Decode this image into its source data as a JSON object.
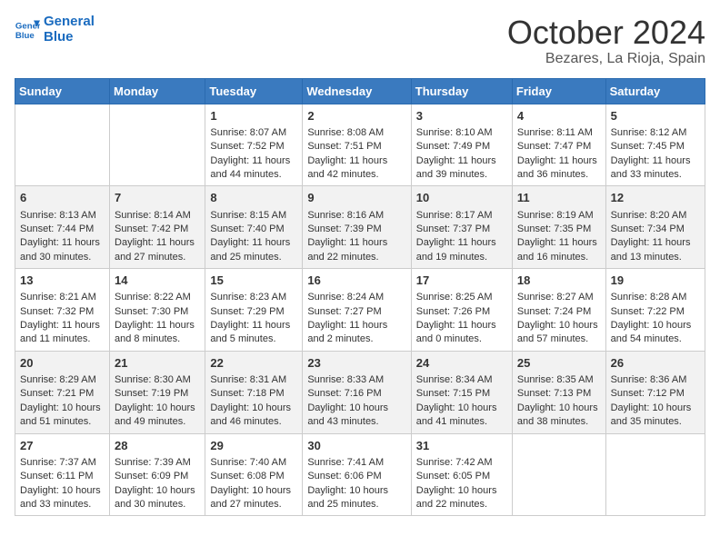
{
  "header": {
    "logo_line1": "General",
    "logo_line2": "Blue",
    "month": "October 2024",
    "location": "Bezares, La Rioja, Spain"
  },
  "days_of_week": [
    "Sunday",
    "Monday",
    "Tuesday",
    "Wednesday",
    "Thursday",
    "Friday",
    "Saturday"
  ],
  "weeks": [
    [
      {
        "day": "",
        "sunrise": "",
        "sunset": "",
        "daylight": ""
      },
      {
        "day": "",
        "sunrise": "",
        "sunset": "",
        "daylight": ""
      },
      {
        "day": "1",
        "sunrise": "Sunrise: 8:07 AM",
        "sunset": "Sunset: 7:52 PM",
        "daylight": "Daylight: 11 hours and 44 minutes."
      },
      {
        "day": "2",
        "sunrise": "Sunrise: 8:08 AM",
        "sunset": "Sunset: 7:51 PM",
        "daylight": "Daylight: 11 hours and 42 minutes."
      },
      {
        "day": "3",
        "sunrise": "Sunrise: 8:10 AM",
        "sunset": "Sunset: 7:49 PM",
        "daylight": "Daylight: 11 hours and 39 minutes."
      },
      {
        "day": "4",
        "sunrise": "Sunrise: 8:11 AM",
        "sunset": "Sunset: 7:47 PM",
        "daylight": "Daylight: 11 hours and 36 minutes."
      },
      {
        "day": "5",
        "sunrise": "Sunrise: 8:12 AM",
        "sunset": "Sunset: 7:45 PM",
        "daylight": "Daylight: 11 hours and 33 minutes."
      }
    ],
    [
      {
        "day": "6",
        "sunrise": "Sunrise: 8:13 AM",
        "sunset": "Sunset: 7:44 PM",
        "daylight": "Daylight: 11 hours and 30 minutes."
      },
      {
        "day": "7",
        "sunrise": "Sunrise: 8:14 AM",
        "sunset": "Sunset: 7:42 PM",
        "daylight": "Daylight: 11 hours and 27 minutes."
      },
      {
        "day": "8",
        "sunrise": "Sunrise: 8:15 AM",
        "sunset": "Sunset: 7:40 PM",
        "daylight": "Daylight: 11 hours and 25 minutes."
      },
      {
        "day": "9",
        "sunrise": "Sunrise: 8:16 AM",
        "sunset": "Sunset: 7:39 PM",
        "daylight": "Daylight: 11 hours and 22 minutes."
      },
      {
        "day": "10",
        "sunrise": "Sunrise: 8:17 AM",
        "sunset": "Sunset: 7:37 PM",
        "daylight": "Daylight: 11 hours and 19 minutes."
      },
      {
        "day": "11",
        "sunrise": "Sunrise: 8:19 AM",
        "sunset": "Sunset: 7:35 PM",
        "daylight": "Daylight: 11 hours and 16 minutes."
      },
      {
        "day": "12",
        "sunrise": "Sunrise: 8:20 AM",
        "sunset": "Sunset: 7:34 PM",
        "daylight": "Daylight: 11 hours and 13 minutes."
      }
    ],
    [
      {
        "day": "13",
        "sunrise": "Sunrise: 8:21 AM",
        "sunset": "Sunset: 7:32 PM",
        "daylight": "Daylight: 11 hours and 11 minutes."
      },
      {
        "day": "14",
        "sunrise": "Sunrise: 8:22 AM",
        "sunset": "Sunset: 7:30 PM",
        "daylight": "Daylight: 11 hours and 8 minutes."
      },
      {
        "day": "15",
        "sunrise": "Sunrise: 8:23 AM",
        "sunset": "Sunset: 7:29 PM",
        "daylight": "Daylight: 11 hours and 5 minutes."
      },
      {
        "day": "16",
        "sunrise": "Sunrise: 8:24 AM",
        "sunset": "Sunset: 7:27 PM",
        "daylight": "Daylight: 11 hours and 2 minutes."
      },
      {
        "day": "17",
        "sunrise": "Sunrise: 8:25 AM",
        "sunset": "Sunset: 7:26 PM",
        "daylight": "Daylight: 11 hours and 0 minutes."
      },
      {
        "day": "18",
        "sunrise": "Sunrise: 8:27 AM",
        "sunset": "Sunset: 7:24 PM",
        "daylight": "Daylight: 10 hours and 57 minutes."
      },
      {
        "day": "19",
        "sunrise": "Sunrise: 8:28 AM",
        "sunset": "Sunset: 7:22 PM",
        "daylight": "Daylight: 10 hours and 54 minutes."
      }
    ],
    [
      {
        "day": "20",
        "sunrise": "Sunrise: 8:29 AM",
        "sunset": "Sunset: 7:21 PM",
        "daylight": "Daylight: 10 hours and 51 minutes."
      },
      {
        "day": "21",
        "sunrise": "Sunrise: 8:30 AM",
        "sunset": "Sunset: 7:19 PM",
        "daylight": "Daylight: 10 hours and 49 minutes."
      },
      {
        "day": "22",
        "sunrise": "Sunrise: 8:31 AM",
        "sunset": "Sunset: 7:18 PM",
        "daylight": "Daylight: 10 hours and 46 minutes."
      },
      {
        "day": "23",
        "sunrise": "Sunrise: 8:33 AM",
        "sunset": "Sunset: 7:16 PM",
        "daylight": "Daylight: 10 hours and 43 minutes."
      },
      {
        "day": "24",
        "sunrise": "Sunrise: 8:34 AM",
        "sunset": "Sunset: 7:15 PM",
        "daylight": "Daylight: 10 hours and 41 minutes."
      },
      {
        "day": "25",
        "sunrise": "Sunrise: 8:35 AM",
        "sunset": "Sunset: 7:13 PM",
        "daylight": "Daylight: 10 hours and 38 minutes."
      },
      {
        "day": "26",
        "sunrise": "Sunrise: 8:36 AM",
        "sunset": "Sunset: 7:12 PM",
        "daylight": "Daylight: 10 hours and 35 minutes."
      }
    ],
    [
      {
        "day": "27",
        "sunrise": "Sunrise: 7:37 AM",
        "sunset": "Sunset: 6:11 PM",
        "daylight": "Daylight: 10 hours and 33 minutes."
      },
      {
        "day": "28",
        "sunrise": "Sunrise: 7:39 AM",
        "sunset": "Sunset: 6:09 PM",
        "daylight": "Daylight: 10 hours and 30 minutes."
      },
      {
        "day": "29",
        "sunrise": "Sunrise: 7:40 AM",
        "sunset": "Sunset: 6:08 PM",
        "daylight": "Daylight: 10 hours and 27 minutes."
      },
      {
        "day": "30",
        "sunrise": "Sunrise: 7:41 AM",
        "sunset": "Sunset: 6:06 PM",
        "daylight": "Daylight: 10 hours and 25 minutes."
      },
      {
        "day": "31",
        "sunrise": "Sunrise: 7:42 AM",
        "sunset": "Sunset: 6:05 PM",
        "daylight": "Daylight: 10 hours and 22 minutes."
      },
      {
        "day": "",
        "sunrise": "",
        "sunset": "",
        "daylight": ""
      },
      {
        "day": "",
        "sunrise": "",
        "sunset": "",
        "daylight": ""
      }
    ]
  ]
}
